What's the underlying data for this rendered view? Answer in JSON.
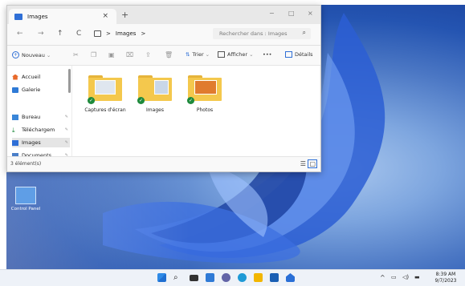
{
  "window": {
    "tab_title": "Images",
    "tab_close": "×",
    "new_tab": "+",
    "controls": {
      "minimize": "−",
      "maximize": "□",
      "close": "×"
    }
  },
  "nav": {
    "back": "←",
    "forward": "→",
    "up": "↑",
    "refresh": "C",
    "path_separator": ">",
    "path_item": "Images",
    "path_trailing": ">",
    "search_placeholder": "Rechercher dans : Images"
  },
  "toolbar": {
    "new_label": "Nouveau",
    "sort_label": "Trier",
    "view_label": "Afficher",
    "more_label": "•••",
    "details_label": "Détails"
  },
  "sidebar": {
    "items": [
      {
        "label": "Accueil"
      },
      {
        "label": "Galerie"
      },
      {
        "label": "Bureau"
      },
      {
        "label": "Téléchargem"
      },
      {
        "label": "Images"
      },
      {
        "label": "Documents"
      }
    ]
  },
  "content": {
    "items": [
      {
        "label": "Captures d'écran"
      },
      {
        "label": "Images"
      },
      {
        "label": "Photos"
      }
    ]
  },
  "status": {
    "text": "3 élément(s)"
  },
  "desktop": {
    "icon_label": "Control Panel"
  },
  "taskbar": {
    "tray_chevron": "^",
    "clock_time": "8:39 AM",
    "clock_date": "9/7/2023"
  },
  "colors": {
    "accent": "#2f6fd6",
    "folder": "#f4c84d",
    "check": "#1e8a3c"
  }
}
